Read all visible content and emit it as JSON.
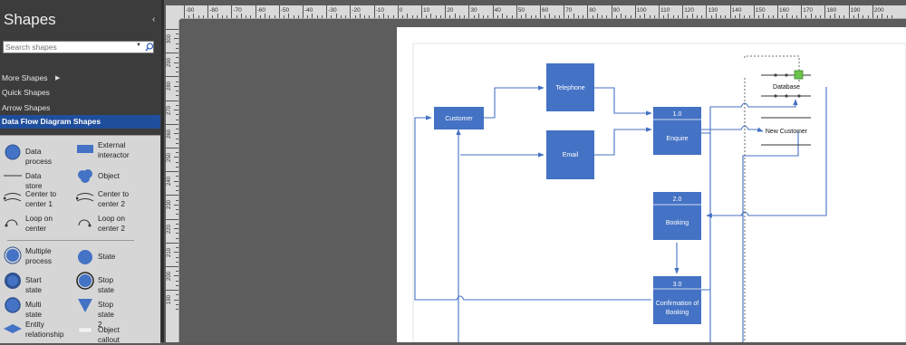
{
  "pane": {
    "title": "Shapes",
    "collapse_glyph": "‹",
    "search_placeholder": "Search shapes",
    "search_icon": "search-icon",
    "more_shapes": "More Shapes",
    "quick_shapes": "Quick Shapes",
    "arrow_shapes": "Arrow Shapes",
    "active_stencil": "Data Flow Diagram Shapes",
    "stencil_items": [
      {
        "label": "Data process",
        "icon": "circle-icon"
      },
      {
        "label": "External interactor",
        "icon": "rectangle-icon"
      },
      {
        "label": "Data store",
        "icon": "data-store-icon"
      },
      {
        "label": "Object",
        "icon": "cloud-icon"
      },
      {
        "label": "Center to center 1",
        "icon": "center-to-center-icon"
      },
      {
        "label": "Center to center 2",
        "icon": "center-to-center-icon"
      },
      {
        "label": "Loop on center",
        "icon": "loop-icon"
      },
      {
        "label": "Loop on center 2",
        "icon": "loop-icon"
      },
      {
        "label": "Multiple process",
        "icon": "multiple-process-icon"
      },
      {
        "label": "State",
        "icon": "circle-icon"
      },
      {
        "label": "Start state",
        "icon": "start-state-icon"
      },
      {
        "label": "Stop state",
        "icon": "stop-state-icon"
      },
      {
        "label": "Multi state",
        "icon": "multi-state-icon"
      },
      {
        "label": "Stop state 2",
        "icon": "triangle-icon"
      },
      {
        "label": "Entity relationship",
        "icon": "diamond-icon"
      },
      {
        "label": "Object callout",
        "icon": "callout-icon"
      }
    ]
  },
  "ruler": {
    "h_labels": [
      "-90",
      "-80",
      "-70",
      "-60",
      "-50",
      "-40",
      "-30",
      "-20",
      "-10",
      "0",
      "10",
      "20",
      "30",
      "40",
      "50",
      "60",
      "70",
      "80",
      "90",
      "100",
      "110",
      "120",
      "130",
      "140",
      "150",
      "160",
      "170",
      "180",
      "190",
      "200"
    ],
    "v_labels": [
      "300",
      "290",
      "280",
      "270",
      "260",
      "250",
      "240",
      "230",
      "220",
      "210",
      "200",
      "190"
    ]
  },
  "diagram": {
    "customer": "Customer",
    "telephone": "Telephone",
    "email": "Email",
    "p1_num": "1.0",
    "p1_name": "Enquire",
    "p2_num": "2.0",
    "p2_name": "Booking",
    "p3_num": "3.0",
    "p3_name_line1": "Confirmation of",
    "p3_name_line2": "Booking",
    "database": "Database",
    "new_customer": "New Customer"
  },
  "colors": {
    "accent": "#4472c4",
    "pane_bg": "#3c3c3c",
    "selected_stencil": "#1f4e9c",
    "selection_handle": "#6cc24a"
  }
}
